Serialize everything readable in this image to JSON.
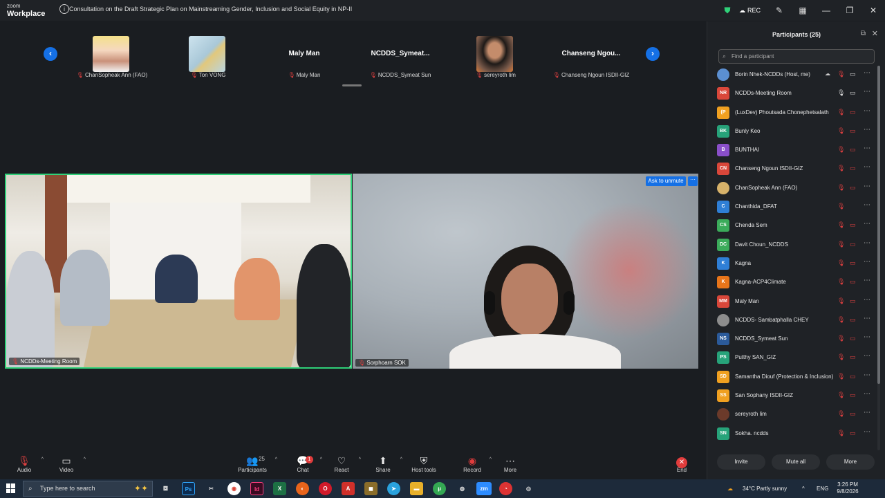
{
  "app": {
    "brand_line1": "zoom",
    "brand_line2": "Workplace",
    "meeting_title": "Consultation on the Draft Strategic Plan on Mainstreaming Gender, Inclusion and Social Equity in NP-II",
    "rec_label": "REC"
  },
  "gallery": {
    "thumbs": [
      {
        "label": "ChanSopheak Ann (FAO)",
        "bigname": ""
      },
      {
        "label": "Ton VONG",
        "bigname": ""
      },
      {
        "label": "Maly Man",
        "bigname": "Maly Man"
      },
      {
        "label": "NCDDS_Symeat Sun",
        "bigname": "NCDDS_Symeat..."
      },
      {
        "label": "sereyroth lim",
        "bigname": ""
      },
      {
        "label": "Chanseng Ngoun ISDII-GIZ",
        "bigname": "Chanseng  Ngou..."
      }
    ],
    "prev_icon": "chevron-left-icon",
    "next_icon": "chevron-right-icon"
  },
  "tiles": {
    "left_label": "NCDDs-Meeting Room",
    "right_label": "Sorphoarn SOK",
    "ask_unmute": "Ask to unmute",
    "more": "···"
  },
  "toolbar": {
    "audio": "Audio",
    "video": "Video",
    "participants": "Participants",
    "participants_count": "25",
    "chat": "Chat",
    "chat_badge": "1",
    "react": "React",
    "share": "Share",
    "host_tools": "Host tools",
    "record": "Record",
    "more": "More",
    "end": "End"
  },
  "panel": {
    "title": "Participants (25)",
    "search_placeholder": "Find a participant",
    "participants": [
      {
        "name": "Borin Nhek-NCDDs (Host, me)",
        "initials": "",
        "color": "#5b8fd1",
        "mic": "muted",
        "cam": "on",
        "share": true
      },
      {
        "name": "NCDDs-Meeting Room",
        "initials": "NR",
        "color": "#d9473a",
        "mic": "on",
        "cam": "on",
        "share": false
      },
      {
        "name": "(LuxDev) Phoutsada Chonephetsalath",
        "initials": "(P",
        "color": "#f0a020",
        "mic": "muted",
        "cam": "off",
        "share": false
      },
      {
        "name": "Bunly Keo",
        "initials": "BK",
        "color": "#27a37a",
        "mic": "muted",
        "cam": "off",
        "share": false
      },
      {
        "name": "BUNTHAI",
        "initials": "B",
        "color": "#8a4fc9",
        "mic": "muted",
        "cam": "off",
        "share": false
      },
      {
        "name": "Chanseng Ngoun ISDII-GIZ",
        "initials": "CN",
        "color": "#d9473a",
        "mic": "muted",
        "cam": "off",
        "share": false
      },
      {
        "name": "ChanSopheak Ann (FAO)",
        "initials": "",
        "color": "#d7b26a",
        "mic": "muted",
        "cam": "off",
        "share": false
      },
      {
        "name": "Chanthida_DFAT",
        "initials": "C",
        "color": "#2f7fd6",
        "mic": "muted",
        "cam": "none",
        "share": false
      },
      {
        "name": "Chenda Sem",
        "initials": "CS",
        "color": "#3bab5a",
        "mic": "muted",
        "cam": "off",
        "share": false
      },
      {
        "name": "Davit Choun_NCDDS",
        "initials": "DC",
        "color": "#3bab5a",
        "mic": "muted",
        "cam": "off",
        "share": false
      },
      {
        "name": "Kagna",
        "initials": "K",
        "color": "#2f7fd6",
        "mic": "muted",
        "cam": "off",
        "share": false
      },
      {
        "name": "Kagna-ACP4Climate",
        "initials": "K",
        "color": "#e8751a",
        "mic": "muted",
        "cam": "off",
        "share": false
      },
      {
        "name": "Maly Man",
        "initials": "MM",
        "color": "#d9473a",
        "mic": "muted",
        "cam": "off",
        "share": false
      },
      {
        "name": "NCDDS- Sambatphalla CHEY",
        "initials": "",
        "color": "#8d8d8d",
        "mic": "muted",
        "cam": "off",
        "share": false
      },
      {
        "name": "NCDDS_Symeat Sun",
        "initials": "NS",
        "color": "#2b5a9a",
        "mic": "muted",
        "cam": "off",
        "share": false
      },
      {
        "name": "Putthy SAN_GIZ",
        "initials": "PS",
        "color": "#27a37a",
        "mic": "muted",
        "cam": "off",
        "share": false
      },
      {
        "name": "Samantha Diouf (Protection & Inclusion)",
        "initials": "SD",
        "color": "#f0a020",
        "mic": "muted",
        "cam": "off",
        "share": false
      },
      {
        "name": "San Sophany ISDII-GIZ",
        "initials": "SS",
        "color": "#f0a020",
        "mic": "muted",
        "cam": "off",
        "share": false
      },
      {
        "name": "sereyroth lim",
        "initials": "",
        "color": "#6b3a2a",
        "mic": "muted",
        "cam": "off",
        "share": false
      },
      {
        "name": "Sokha. ncdds",
        "initials": "SN",
        "color": "#27a37a",
        "mic": "muted",
        "cam": "off",
        "share": false
      }
    ],
    "invite": "Invite",
    "mute_all": "Mute all",
    "more": "More"
  },
  "taskbar": {
    "search_placeholder": "Type here to search",
    "weather": "34°C  Partly sunny",
    "lang": "ENG",
    "time": "3:26 PM",
    "date": "9/8/2026"
  },
  "colors": {
    "accent_blue": "#1570e5",
    "speaker_green": "#2fd179",
    "muted_red": "#e04040"
  }
}
